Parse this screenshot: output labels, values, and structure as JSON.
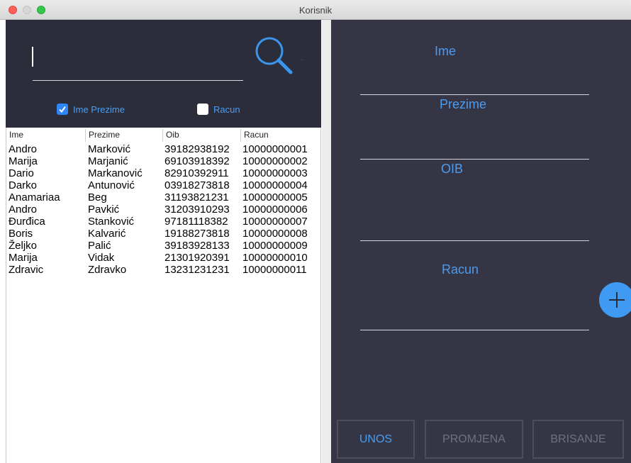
{
  "window": {
    "title": "Korisnik"
  },
  "search": {
    "value": "",
    "dots": ".."
  },
  "filters": {
    "ime_prezime": {
      "label": "Ime Prezime",
      "checked": true
    },
    "racun": {
      "label": "Racun",
      "checked": false
    }
  },
  "table": {
    "headers": [
      "Ime",
      "Prezime",
      "Oib",
      "Racun"
    ],
    "rows": [
      [
        "Andro",
        "Marković",
        "39182938192",
        "10000000001"
      ],
      [
        "Marija",
        "Marjanić",
        "69103918392",
        "10000000002"
      ],
      [
        "Dario",
        "Markanović",
        "82910392911",
        "10000000003"
      ],
      [
        "Darko",
        "Antunović",
        "03918273818",
        "10000000004"
      ],
      [
        "Anamariaa",
        "Beg",
        "31193821231",
        "10000000005"
      ],
      [
        "Andro",
        "Pavkić",
        "31203910293",
        "10000000006"
      ],
      [
        "Đurđica",
        "Stanković",
        "97181118382",
        "10000000007"
      ],
      [
        "Boris",
        "Kalvarić",
        "19188273818",
        "10000000008"
      ],
      [
        "Željko",
        "Palić",
        "39183928133",
        "10000000009"
      ],
      [
        "Marija",
        "Vidak",
        "21301920391",
        "10000000010"
      ],
      [
        "Zdravic",
        "Zdravko",
        "13231231231",
        "10000000011"
      ]
    ]
  },
  "form": {
    "ime_label": "Ime",
    "prezime_label": "Prezime",
    "oib_label": "OIB",
    "racun_label": "Racun"
  },
  "actions": {
    "unos": "UNOS",
    "promjena": "PROMJENA",
    "brisanje": "BRISANJE"
  },
  "colors": {
    "panel_dark": "#2c2d3a",
    "panel_right": "#353546",
    "accent": "#4a9cf0",
    "checkbox": "#2f86f6",
    "fab": "#3e9af3"
  },
  "icons": {
    "search": "search-icon",
    "add": "plus-icon",
    "check": "checkmark-icon"
  }
}
